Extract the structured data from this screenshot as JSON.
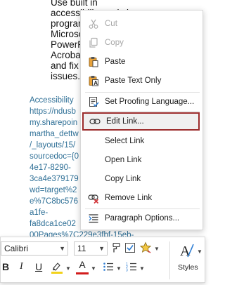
{
  "document": {
    "body_lines": [
      "Use built in",
      "accessibility tools in",
      "program",
      "Microso",
      "PowerP",
      "Acroba",
      "and fix",
      "issues."
    ],
    "link_lines": [
      "Accessibility",
      "https://ndusb",
      "my.sharepoin",
      "martha_dettw",
      "/_layouts/15/",
      "sourcedoc={0",
      "4e17-8290-",
      "3ca4e379179",
      "wd=target%2",
      "e%7C8bc576",
      "a1fe-",
      "fa8dca1ce02",
      "00Pages%7C229e3fbf-15eb-"
    ]
  },
  "context_menu": {
    "items": [
      {
        "label": "Cut",
        "icon": "scissors-icon",
        "enabled": false
      },
      {
        "label": "Copy",
        "icon": "copy-icon",
        "enabled": false
      },
      {
        "label": "Paste",
        "icon": "paste-icon",
        "enabled": true
      },
      {
        "label": "Paste Text Only",
        "icon": "paste-text-only-icon",
        "enabled": true
      },
      {
        "label": "Set Proofing Language...",
        "icon": "proofing-language-icon",
        "enabled": true
      },
      {
        "label": "Edit Link...",
        "icon": "link-icon",
        "enabled": true,
        "highlighted": true
      },
      {
        "label": "Select Link",
        "enabled": true
      },
      {
        "label": "Open Link",
        "enabled": true
      },
      {
        "label": "Copy Link",
        "enabled": true
      },
      {
        "label": "Remove Link",
        "icon": "remove-link-icon",
        "enabled": true
      },
      {
        "label": "Paragraph Options...",
        "icon": "paragraph-options-icon",
        "enabled": true
      }
    ],
    "highlight_color": "#9b2c2c"
  },
  "toolbar": {
    "font_name": "Calibri",
    "font_size": "11",
    "bold": "B",
    "italic": "I",
    "underline": "U",
    "font_color_letter": "A",
    "styles_label": "Styles",
    "highlight_color": "#f2d21b",
    "font_color": "#d21c1c"
  }
}
